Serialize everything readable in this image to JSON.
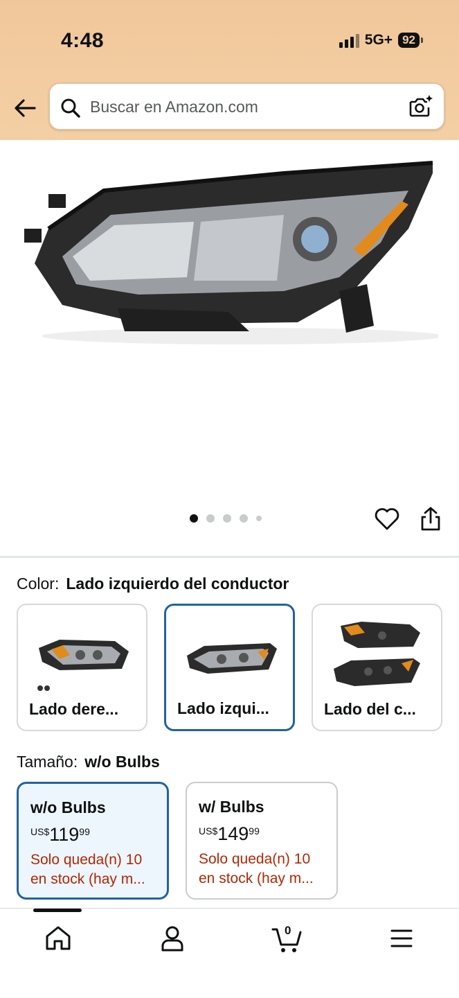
{
  "status_bar": {
    "time": "4:48",
    "network": "5G+",
    "battery": "92"
  },
  "search": {
    "placeholder": "Buscar en Amazon.com"
  },
  "gallery": {
    "total_images": 5,
    "active_index": 0
  },
  "color": {
    "label": "Color:",
    "selected": "Lado izquierdo del conductor",
    "options": [
      {
        "label": "Lado dere..."
      },
      {
        "label": "Lado izqui..."
      },
      {
        "label": "Lado del c..."
      }
    ]
  },
  "size": {
    "label": "Tamaño:",
    "selected": "w/o Bulbs",
    "options": [
      {
        "name": "w/o Bulbs",
        "currency": "US$",
        "whole": "119",
        "fraction": "99",
        "stock_line1": "Solo queda(n) 10",
        "stock_line2": "en stock (hay m..."
      },
      {
        "name": "w/ Bulbs",
        "currency": "US$",
        "whole": "149",
        "fraction": "99",
        "stock_line1": "Solo queda(n) 10",
        "stock_line2": "en stock (hay m..."
      }
    ]
  },
  "nav": {
    "cart_count": "0"
  },
  "colors": {
    "accent": "#2162a1",
    "stock_red": "#b12704",
    "header_bg": "#f3cca1"
  }
}
